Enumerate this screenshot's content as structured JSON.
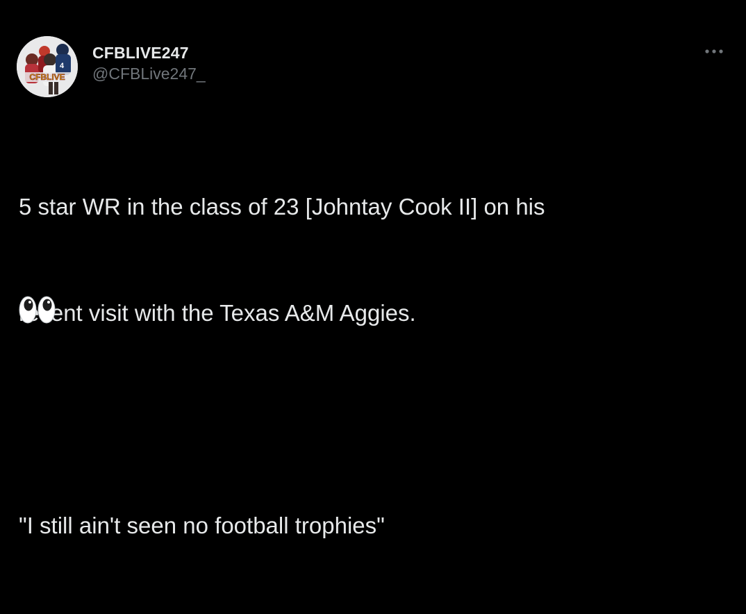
{
  "author": {
    "display_name": "CFBLIVE247",
    "handle": "@CFBLive247_",
    "avatar_text": "CFBLIVE"
  },
  "tweet": {
    "lines": [
      "5 star WR in the class of 23 [Johntay Cook II] on his",
      "recent visit with the Texas A&M Aggies.",
      "\"I still ain't seen no football trophies\""
    ],
    "emoji": "eyes"
  },
  "icons": {
    "more": "more-horizontal-icon"
  },
  "colors": {
    "background": "#000000",
    "text": "#e7e9ea",
    "secondary_text": "#71767b"
  }
}
